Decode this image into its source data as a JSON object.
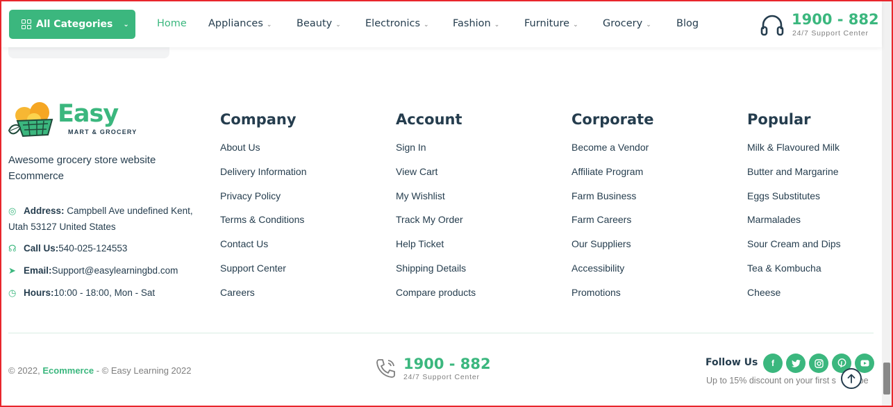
{
  "header": {
    "categories_button": "All Categories",
    "nav": [
      {
        "label": "Home",
        "active": true,
        "dropdown": false
      },
      {
        "label": "Appliances",
        "active": false,
        "dropdown": true
      },
      {
        "label": "Beauty",
        "active": false,
        "dropdown": true
      },
      {
        "label": "Electronics",
        "active": false,
        "dropdown": true
      },
      {
        "label": "Fashion",
        "active": false,
        "dropdown": true
      },
      {
        "label": "Furniture",
        "active": false,
        "dropdown": true
      },
      {
        "label": "Grocery",
        "active": false,
        "dropdown": true
      },
      {
        "label": "Blog",
        "active": false,
        "dropdown": false
      }
    ],
    "support_number": "1900 - 882",
    "support_label": "24/7 Support Center"
  },
  "footer": {
    "logo": {
      "name": "Easy",
      "tagline": "MART & GROCERY"
    },
    "description": "Awesome grocery store website Ecommerce",
    "contact": {
      "address_label": "Address:",
      "address_value": "Campbell Ave undefined Kent, Utah 53127 United States",
      "call_label": "Call Us:",
      "call_value": "540-025-124553",
      "email_label": "Email:",
      "email_value": "Support@easylearningbd.com",
      "hours_label": "Hours:",
      "hours_value": "10:00 - 18:00, Mon - Sat"
    },
    "columns": [
      {
        "title": "Company",
        "links": [
          "About Us",
          "Delivery Information",
          "Privacy Policy",
          "Terms & Conditions",
          "Contact Us",
          "Support Center",
          "Careers"
        ]
      },
      {
        "title": "Account",
        "links": [
          "Sign In",
          "View Cart",
          "My Wishlist",
          "Track My Order",
          "Help Ticket",
          "Shipping Details",
          "Compare products"
        ]
      },
      {
        "title": "Corporate",
        "links": [
          "Become a Vendor",
          "Affiliate Program",
          "Farm Business",
          "Farm Careers",
          "Our Suppliers",
          "Accessibility",
          "Promotions"
        ]
      },
      {
        "title": "Popular",
        "links": [
          "Milk & Flavoured Milk",
          "Butter and Margarine",
          "Eggs Substitutes",
          "Marmalades",
          "Sour Cream and Dips",
          "Tea & Kombucha",
          "Cheese"
        ]
      }
    ],
    "bottom": {
      "copyright_prefix": "© 2022,",
      "copyright_brand": "Ecommerce",
      "copyright_suffix": "- © Easy Learning 2022",
      "phone_number": "1900 - 882",
      "phone_label": "24/7 Support Center",
      "follow_label": "Follow Us",
      "social": [
        "facebook",
        "twitter",
        "instagram",
        "pinterest",
        "youtube"
      ],
      "discount_text_start": "Up to 15% discount on your first s",
      "discount_text_end": "ibe"
    }
  },
  "colors": {
    "accent": "#3bb77e",
    "text": "#253d4e",
    "muted": "#7e7e7e",
    "frame": "#e8262c"
  }
}
